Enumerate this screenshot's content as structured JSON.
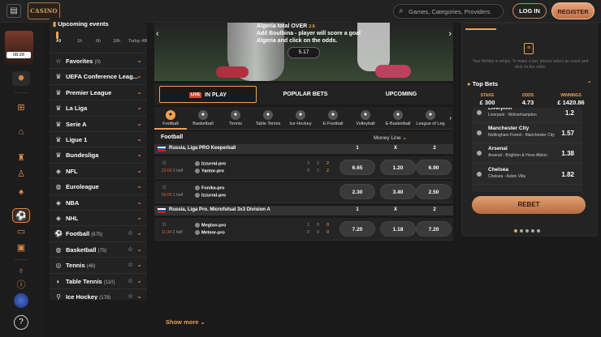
{
  "header": {
    "logo_text": "CASINO",
    "search_placeholder": "Games, Categories, Providers",
    "login_label": "LOG IN",
    "register_label": "REGISTER"
  },
  "rail": {
    "promo_time": "08:28"
  },
  "sidebar": {
    "title": "Upcoming events",
    "filters": [
      "All",
      "1h",
      "6h",
      "18h",
      "Today",
      "48h"
    ],
    "items": [
      {
        "label": "Favorites",
        "count": "(0)",
        "icon": "star-icon"
      },
      {
        "label": "UEFA Conference Leag...",
        "count": "",
        "icon": "trophy-icon"
      },
      {
        "label": "Premier League",
        "count": "",
        "icon": "trophy-icon"
      },
      {
        "label": "La Liga",
        "count": "",
        "icon": "trophy-icon"
      },
      {
        "label": "Serie A",
        "count": "",
        "icon": "trophy-icon"
      },
      {
        "label": "Ligue 1",
        "count": "",
        "icon": "trophy-icon"
      },
      {
        "label": "Bundesliga",
        "count": "",
        "icon": "trophy-icon"
      },
      {
        "label": "NFL",
        "count": "",
        "icon": "shield-icon"
      },
      {
        "label": "Euroleague",
        "count": "",
        "icon": "basketball-icon"
      },
      {
        "label": "NBA",
        "count": "",
        "icon": "shield-icon"
      },
      {
        "label": "NHL",
        "count": "",
        "icon": "shield-icon"
      },
      {
        "label": "Football",
        "count": "(675)",
        "icon": "football-icon"
      },
      {
        "label": "Basketball",
        "count": "(75)",
        "icon": "basketball-icon"
      },
      {
        "label": "Tennis",
        "count": "(48)",
        "icon": "tennis-icon"
      },
      {
        "label": "Table Tennis",
        "count": "(110)",
        "icon": "table-tennis-icon"
      },
      {
        "label": "Ice Hockey",
        "count": "(178)",
        "icon": "hockey-icon"
      }
    ]
  },
  "banner": {
    "line1": "Algeria total OVER",
    "line1_odd": "2.6",
    "line2": "Adil Boulbina - player will score a goal",
    "line3": "Algeria and click on the odds.",
    "odd": "5.17"
  },
  "main_tabs": {
    "live": "LIVE",
    "in_play": "IN PLAY",
    "popular": "POPULAR BETS",
    "upcoming": "UPCOMING"
  },
  "sports": [
    "Football",
    "Basketball",
    "Tennis",
    "Table Tennis",
    "Ice Hockey",
    "E-Football",
    "Volleyball",
    "E-Basketball",
    "League of Leg"
  ],
  "market": {
    "sport": "Football",
    "type": "Money Line"
  },
  "leagues": [
    {
      "name": "Russia, Liga PRO Keeperball",
      "cols": [
        "1",
        "X",
        "2"
      ],
      "events": [
        {
          "time": "22:09",
          "period": "2 half",
          "team1": "Izzurral-pro",
          "team2": "Yantor-pro",
          "s1": [
            "3",
            "2",
            "2"
          ],
          "s2": [
            "0",
            "2",
            "2"
          ],
          "odds": [
            "6.65",
            "1.20",
            "6.90"
          ]
        },
        {
          "time": "00:00",
          "period": "1 half",
          "team1": "Fonika-pro",
          "team2": "Izzurral-pro",
          "s1": [
            "",
            "",
            ""
          ],
          "s2": [
            "",
            "",
            ""
          ],
          "odds": [
            "2.30",
            "3.40",
            "2.50"
          ]
        }
      ]
    },
    {
      "name": "Russia, Liga Pro. Microfutsal 3x3 Division A",
      "cols": [
        "1",
        "X",
        "2"
      ],
      "events": [
        {
          "time": "11:34",
          "period": "2 half",
          "team1": "Megton-pro",
          "team2": "Meteor-pro",
          "s1": [
            "2",
            "0",
            "0"
          ],
          "s2": [
            "0",
            "0",
            "0"
          ],
          "odds": [
            "7.20",
            "1.18",
            "7.20"
          ]
        }
      ]
    }
  ],
  "show_more": "Show more",
  "betslip": {
    "empty": "Your Betslip is empty. To make a bet, please select an event and click on the odds.",
    "top_bets_title": "Top Bets",
    "stake_label": "STAKE",
    "stake": "£ 300",
    "odds_label": "ODDS",
    "odds": "4.73",
    "win_label": "WINNINGS",
    "win": "£ 1420.86",
    "items": [
      {
        "team": "Liverpool",
        "match": "Liverpool - Wolverhampton",
        "odd": "1.2"
      },
      {
        "team": "Manchester City",
        "match": "Nottingham Forest - Manchester City",
        "odd": "1.57"
      },
      {
        "team": "Arsenal",
        "match": "Arsenal - Brighton & Hove Albion",
        "odd": "1.38"
      },
      {
        "team": "Chelsea",
        "match": "Chelsea - Aston Villa",
        "odd": "1.82"
      }
    ],
    "rebet": "REBET"
  }
}
